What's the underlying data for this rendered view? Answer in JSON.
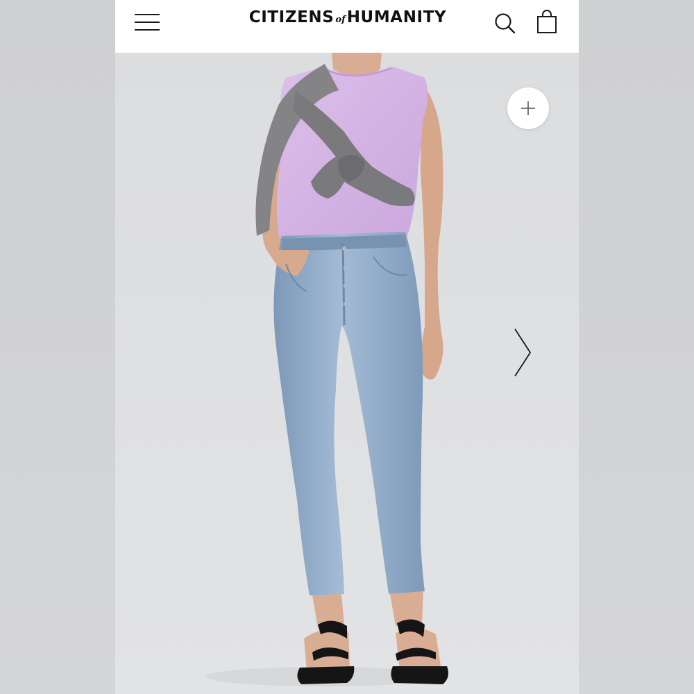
{
  "header": {
    "brand": {
      "word1": "CITIZENS",
      "joiner": "of",
      "word2": "HUMANITY"
    }
  },
  "icons": {
    "menu": "hamburger-menu-icon",
    "search": "search-icon",
    "bag": "shopping-bag-icon",
    "zoom": "plus-icon",
    "next": "chevron-right-icon"
  },
  "colors": {
    "header_bg": "#ffffff",
    "page_bg": "#d8d9db",
    "top": "#d8b7e6",
    "sweater": "#7d7d7f",
    "denim": "#8fa9c6",
    "sandals": "#151515"
  }
}
